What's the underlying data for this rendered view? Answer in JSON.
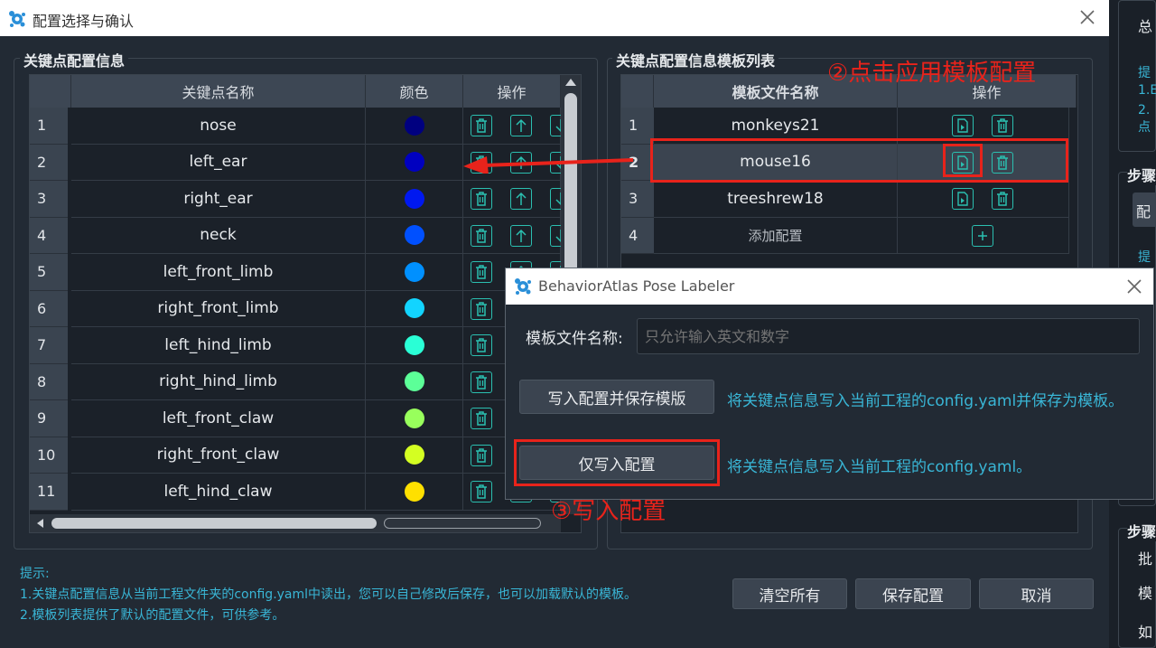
{
  "window": {
    "title": "配置选择与确认"
  },
  "left_group": {
    "title": "关键点配置信息",
    "headers": [
      "关键点名称",
      "颜色",
      "操作"
    ],
    "rows": [
      {
        "num": "1",
        "name": "nose",
        "color": "#000080"
      },
      {
        "num": "2",
        "name": "left_ear",
        "color": "#0000c0"
      },
      {
        "num": "3",
        "name": "right_ear",
        "color": "#0018f0"
      },
      {
        "num": "4",
        "name": "neck",
        "color": "#0050ff"
      },
      {
        "num": "5",
        "name": "left_front_limb",
        "color": "#0090ff"
      },
      {
        "num": "6",
        "name": "right_front_limb",
        "color": "#12d4ff"
      },
      {
        "num": "7",
        "name": "left_hind_limb",
        "color": "#2affd6"
      },
      {
        "num": "8",
        "name": "right_hind_limb",
        "color": "#5cff98"
      },
      {
        "num": "9",
        "name": "left_front_claw",
        "color": "#98ff5c"
      },
      {
        "num": "10",
        "name": "right_front_claw",
        "color": "#d4ff22"
      },
      {
        "num": "11",
        "name": "left_hind_claw",
        "color": "#ffe000"
      }
    ]
  },
  "right_group": {
    "title": "关键点配置信息模板列表",
    "headers": [
      "模板文件名称",
      "操作"
    ],
    "rows": [
      {
        "num": "1",
        "name": "monkeys21"
      },
      {
        "num": "2",
        "name": "mouse16"
      },
      {
        "num": "3",
        "name": "treeshrew18"
      },
      {
        "num": "4",
        "name": "添加配置"
      }
    ]
  },
  "annotations": {
    "step2": "②点击应用模板配置",
    "step3": "③写入配置"
  },
  "hints": {
    "title": "提示:",
    "line1": "1.关键点配置信息从当前工程文件夹的config.yaml中读出，您可以自己修改后保存，也可以加载默认的模板。",
    "line2": "2.模板列表提供了默认的配置文件，可供参考。"
  },
  "buttons": {
    "clear_all": "清空所有",
    "save_config": "保存配置",
    "cancel": "取消"
  },
  "dialog": {
    "title": "BehaviorAtlas Pose Labeler",
    "name_label": "模板文件名称:",
    "name_placeholder": "只允许输入英文和数字",
    "write_save_label": "写入配置并保存模版",
    "write_save_desc": "将关键点信息写入当前工程的config.yaml并保存为模板。",
    "write_only_label": "仅写入配置",
    "write_only_desc": "将关键点信息写入当前工程的config.yaml。"
  },
  "side": {
    "items": [
      "总",
      "提",
      "1.E",
      "2.点",
      "步骤",
      "配",
      "提",
      "步骤",
      "批",
      "模",
      "如"
    ]
  },
  "colors": {
    "accent": "#2bbfb0",
    "annotation_red": "#e8231b",
    "hint_blue": "#39b6d6"
  }
}
